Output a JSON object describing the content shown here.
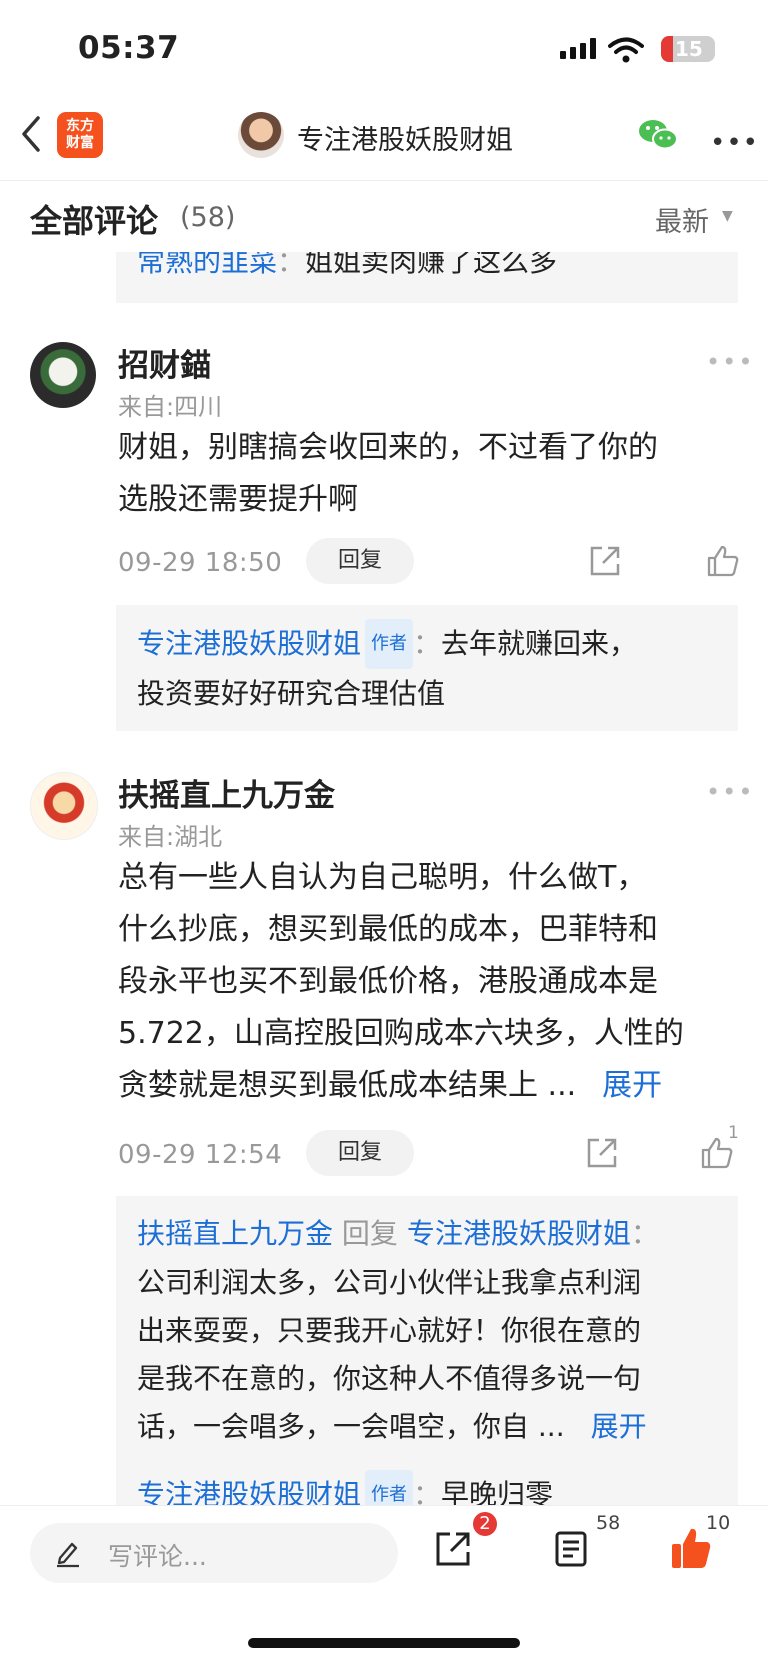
{
  "status": {
    "time": "05:37",
    "battery": "15"
  },
  "nav": {
    "logo_line1": "东方",
    "logo_line2": "财富",
    "title": "专注港股妖股财姐"
  },
  "section": {
    "title": "全部评论",
    "count": "(58)",
    "sort": "最新"
  },
  "comments": [
    {
      "partial_reply": {
        "user": "常熟的韭菜",
        "sep": "：",
        "text": "姐姐卖肉赚了这么多"
      }
    },
    {
      "user": "招财錨",
      "location": "来自:四川",
      "body": [
        "财姐，别瞎搞会收回来的，不过看了你的",
        "选股还需要提升啊"
      ],
      "time": "09-29 18:50",
      "reply_label": "回复",
      "replies": [
        {
          "user": "专注港股妖股财姐",
          "tag": "作者",
          "sep": "：",
          "line1": "去年就赚回来，",
          "line2": "投资要好好研究合理估值"
        }
      ]
    },
    {
      "user": "扶摇直上九万金",
      "location": "来自:湖北",
      "body": [
        "总有一些人自认为自己聪明，什么做T，",
        "什么抄底，想买到最低的成本，巴菲特和",
        "段永平也买不到最低价格，港股通成本是",
        "5.722，山高控股回购成本六块多，人性的",
        "贪婪就是想买到最低成本结果上 ..."
      ],
      "expand": "展开",
      "time": "09-29 12:54",
      "reply_label": "回复",
      "likes": "1",
      "replies": [
        {
          "user": "扶摇直上九万金",
          "mid": "回复",
          "target": "专注港股妖股财姐",
          "sep": "：",
          "lines": [
            "公司利润太多，公司小伙伴让我拿点利润",
            "出来耍耍，只要我开心就好！你很在意的",
            "是我不在意的，你这种人不值得多说一句",
            "话，一会唱多，一会唱空，你自 ..."
          ],
          "expand": "展开"
        },
        {
          "user": "专注港股妖股财姐",
          "tag": "作者",
          "sep": "：",
          "text": "早晚归零"
        }
      ]
    }
  ],
  "bottom": {
    "placeholder": "写评论...",
    "share_badge": "2",
    "comment_count": "58",
    "like_count": "10"
  }
}
